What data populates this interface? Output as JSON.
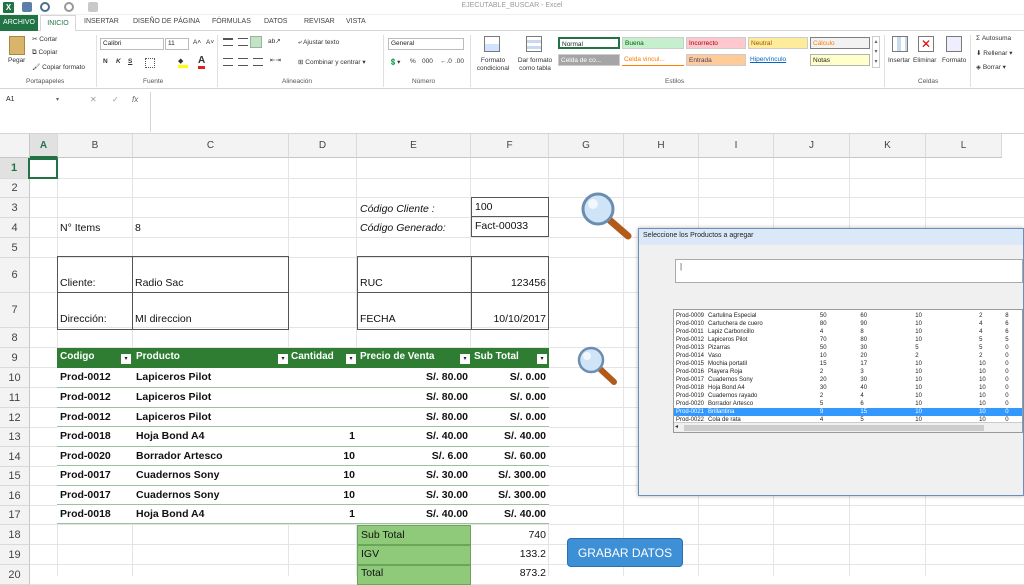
{
  "window": {
    "title": "EJECUTABLE_BUSCAR - Excel"
  },
  "tabs": [
    "ARCHIVO",
    "INICIO",
    "INSERTAR",
    "DISEÑO DE PÁGINA",
    "FÓRMULAS",
    "DATOS",
    "REVISAR",
    "VISTA"
  ],
  "ribbon": {
    "pegar": "Pegar",
    "cortar": "Cortar",
    "copiar": "Copiar",
    "copiar_formato": "Copiar formato",
    "portapapeles": "Portapapeles",
    "font_name": "Calibri",
    "font_size": "11",
    "fuente": "Fuente",
    "ajustar_texto": "Ajustar texto",
    "combinar": "Combinar y centrar",
    "alineacion": "Alineación",
    "number_format": "General",
    "numero": "Número",
    "formato_condicional": "Formato condicional",
    "dar_formato": "Dar formato como tabla",
    "estilos": "Estilos",
    "styles": [
      "Normal",
      "Buena",
      "Incorrecto",
      "Neutral",
      "Cálculo",
      "Celda de co...",
      "Celda vincul...",
      "Entrada",
      "Hipervínculo",
      "Notas"
    ],
    "insertar": "Insertar",
    "eliminar": "Eliminar",
    "formato": "Formato",
    "celdas": "Celdas",
    "autosuma": "Autosuma",
    "rellenar": "Rellenar",
    "borrar": "Borrar",
    "bold": "N",
    "italic": "K",
    "underline": "S",
    "percent": "%",
    "thousands": "000"
  },
  "formula_bar": {
    "name_box": "A1",
    "fx": "fx",
    "value": ""
  },
  "columns": [
    "A",
    "B",
    "C",
    "D",
    "E",
    "F",
    "G",
    "H",
    "I",
    "J",
    "K",
    "L"
  ],
  "rows": [
    "1",
    "2",
    "3",
    "4",
    "5",
    "6",
    "7",
    "8",
    "9",
    "10",
    "11",
    "12",
    "13",
    "14",
    "15",
    "16",
    "17",
    "18",
    "19",
    "20"
  ],
  "sheet": {
    "codigo_cliente_label": "Código Cliente :",
    "codigo_cliente": "100",
    "codigo_generado_label": "Código Generado:",
    "codigo_generado": "Fact-00033",
    "items_label": "N° Items",
    "items": "8",
    "cliente_label": "Cliente:",
    "cliente": "Radio Sac",
    "ruc_label": "RUC",
    "ruc": "123456",
    "direccion_label": "Dirección:",
    "direccion": "MI direccion",
    "fecha_label": "FECHA",
    "fecha": "10/10/2017",
    "headers": [
      "Codigo",
      "Producto",
      "Cantidad",
      "Precio de Venta",
      "Sub Total"
    ],
    "lines": [
      {
        "codigo": "Prod-0012",
        "producto": "Lapiceros Pilot",
        "cantidad": "",
        "precio": "S/. 80.00",
        "subtotal": "S/. 0.00"
      },
      {
        "codigo": "Prod-0012",
        "producto": "Lapiceros Pilot",
        "cantidad": "",
        "precio": "S/. 80.00",
        "subtotal": "S/. 0.00"
      },
      {
        "codigo": "Prod-0012",
        "producto": "Lapiceros Pilot",
        "cantidad": "",
        "precio": "S/. 80.00",
        "subtotal": "S/. 0.00"
      },
      {
        "codigo": "Prod-0018",
        "producto": "Hoja Bond A4",
        "cantidad": "1",
        "precio": "S/. 40.00",
        "subtotal": "S/. 40.00"
      },
      {
        "codigo": "Prod-0020",
        "producto": "Borrador Artesco",
        "cantidad": "10",
        "precio": "S/. 6.00",
        "subtotal": "S/. 60.00"
      },
      {
        "codigo": "Prod-0017",
        "producto": "Cuadernos Sony",
        "cantidad": "10",
        "precio": "S/. 30.00",
        "subtotal": "S/. 300.00"
      },
      {
        "codigo": "Prod-0017",
        "producto": "Cuadernos Sony",
        "cantidad": "10",
        "precio": "S/. 30.00",
        "subtotal": "S/. 300.00"
      },
      {
        "codigo": "Prod-0018",
        "producto": "Hoja Bond A4",
        "cantidad": "1",
        "precio": "S/. 40.00",
        "subtotal": "S/. 40.00"
      }
    ],
    "subtotal_label": "Sub Total",
    "subtotal": "740",
    "igv_label": "IGV",
    "igv": "133.2",
    "total_label": "Total",
    "total": "873.2"
  },
  "grabar_button": "GRABAR DATOS",
  "dialog": {
    "title": "Seleccione los Productos a agregar",
    "search_value": "|",
    "products": [
      [
        "Prod-0009",
        "Cartulina Especial",
        "50",
        "60",
        "10",
        "2",
        "8"
      ],
      [
        "Prod-0010",
        "Cartuchera de cuero",
        "80",
        "90",
        "10",
        "4",
        "6"
      ],
      [
        "Prod-0011",
        "Lapiz Carboncillo",
        "4",
        "8",
        "10",
        "4",
        "6"
      ],
      [
        "Prod-0012",
        "Lapiceros Pilot",
        "70",
        "80",
        "10",
        "5",
        "5"
      ],
      [
        "Prod-0013",
        "Pizarras",
        "50",
        "30",
        "5",
        "5",
        "0"
      ],
      [
        "Prod-0014",
        "Vaso",
        "10",
        "20",
        "2",
        "2",
        "0"
      ],
      [
        "Prod-0015",
        "Mochia portatil",
        "15",
        "17",
        "10",
        "10",
        "0"
      ],
      [
        "Prod-0016",
        "Playera Roja",
        "2",
        "3",
        "10",
        "10",
        "0"
      ],
      [
        "Prod-0017",
        "Cuadernos Sony",
        "20",
        "30",
        "10",
        "10",
        "0"
      ],
      [
        "Prod-0018",
        "Hoja Bond A4",
        "30",
        "40",
        "10",
        "10",
        "0"
      ],
      [
        "Prod-0019",
        "Cuadernos rayado",
        "2",
        "4",
        "10",
        "10",
        "0"
      ],
      [
        "Prod-0020",
        "Borrador Artesco",
        "5",
        "6",
        "10",
        "10",
        "0"
      ],
      [
        "Prod-0021",
        "Brillantina",
        "9",
        "15",
        "10",
        "10",
        "0"
      ],
      [
        "Prod-0022",
        "Cola de rata",
        "4",
        "5",
        "10",
        "10",
        "0"
      ]
    ],
    "selected_index": 12
  },
  "colors": {
    "excel_green": "#217346",
    "table_header": "#2e7d32",
    "totals_fill": "#8fc97a",
    "button_blue": "#3d8fd6",
    "selection_blue": "#3399ff"
  }
}
